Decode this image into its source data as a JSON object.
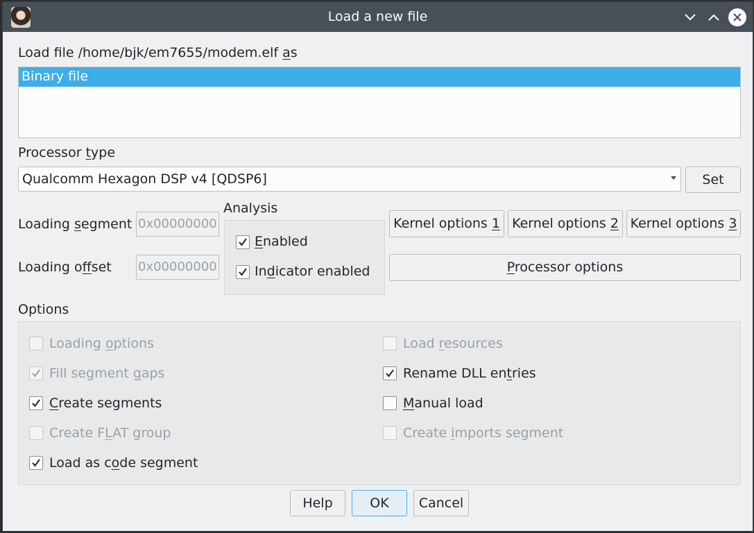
{
  "window": {
    "title": "Load a new file",
    "controls": [
      "chevron-down-icon",
      "chevron-up-icon",
      "close-circle-icon"
    ]
  },
  "load_file": {
    "label_prefix": "Load file /home/bjk/em7655/modem.elf ",
    "label_mnemonic": "a",
    "label_suffix": "s",
    "formats": [
      "Binary file"
    ],
    "selected_format": "Binary file"
  },
  "processor": {
    "label_prefix": "Processor ",
    "label_mnemonic": "t",
    "label_suffix": "ype",
    "selected": "Qualcomm Hexagon DSP v4 [QDSP6]",
    "set_label": "Set"
  },
  "loading": {
    "segment_label_a": "Loading ",
    "segment_label_m": "s",
    "segment_label_b": "egment",
    "segment_value": "0x00000000",
    "offset_label_a": "Loading o",
    "offset_label_m": "f",
    "offset_label_b": "fset",
    "offset_value": "0x00000000"
  },
  "analysis": {
    "title": "Analysis",
    "enabled_m": "E",
    "enabled_rest": "nabled",
    "enabled_checked": true,
    "indicator_a": "In",
    "indicator_m": "d",
    "indicator_b": "icator enabled",
    "indicator_checked": true
  },
  "buttons": {
    "kernel1_a": "Kernel options ",
    "kernel1_m": "1",
    "kernel2_a": "Kernel options ",
    "kernel2_m": "2",
    "kernel3_a": "Kernel options ",
    "kernel3_m": "3",
    "processor_options_m": "P",
    "processor_options_rest": "rocessor options",
    "help": "Help",
    "ok": "OK",
    "cancel": "Cancel"
  },
  "options": {
    "title": "Options",
    "loading_options": {
      "a": "Loading ",
      "m": "o",
      "b": "ptions",
      "checked": false,
      "enabled": false
    },
    "fill_segment_gaps": {
      "a": "Fill segment ",
      "m": "g",
      "b": "aps",
      "checked": true,
      "enabled": false
    },
    "create_segments": {
      "a": "",
      "m": "C",
      "b": "reate segments",
      "checked": true,
      "enabled": true
    },
    "create_flat_group": {
      "a": "Create F",
      "m": "L",
      "b": "AT group",
      "checked": false,
      "enabled": false
    },
    "load_as_code_segment": {
      "a": "Load as c",
      "m": "o",
      "b": "de segment",
      "checked": true,
      "enabled": true
    },
    "load_resources": {
      "a": "Load ",
      "m": "r",
      "b": "esources",
      "checked": false,
      "enabled": false
    },
    "rename_dll_entries": {
      "a": "Rename DLL en",
      "m": "t",
      "b": "ries",
      "checked": true,
      "enabled": true
    },
    "manual_load": {
      "a": "",
      "m": "M",
      "b": "anual load",
      "checked": false,
      "enabled": true
    },
    "create_imports_segment": {
      "a": "Create ",
      "m": "i",
      "b": "mports segment",
      "checked": false,
      "enabled": false
    }
  }
}
